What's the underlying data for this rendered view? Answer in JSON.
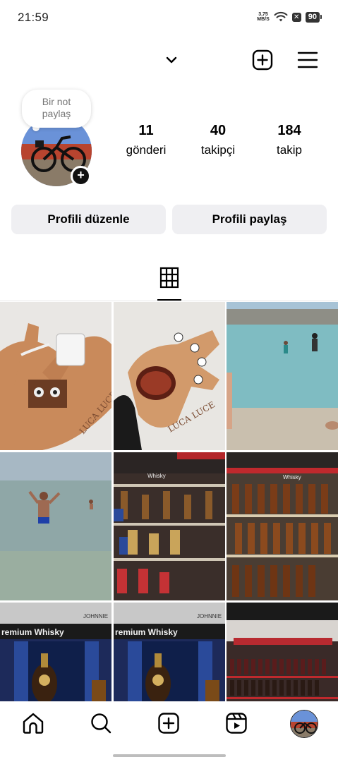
{
  "status_bar": {
    "time": "21:59",
    "net_speed_value": "3,75",
    "net_speed_unit": "MB/S",
    "sim_icon": "x-box-icon",
    "battery": "90"
  },
  "header": {
    "username_dropdown_icon": "chevron-down-icon",
    "new_post_icon": "plus-square-icon",
    "menu_icon": "hamburger-menu-icon"
  },
  "profile": {
    "note_bubble": "Bir not\npaylaş",
    "stats": [
      {
        "value": "11",
        "label": "gönderi"
      },
      {
        "value": "40",
        "label": "takipçi"
      },
      {
        "value": "184",
        "label": "takip"
      }
    ],
    "edit_button": "Profili düzenle",
    "share_button": "Profili paylaş"
  },
  "tabs": {
    "active": "grid-icon"
  },
  "grid": {
    "posts": [
      {
        "subject": "hand illusion with charger",
        "caption_overlay": "LUCA LUCE"
      },
      {
        "subject": "hand illusion with mouth",
        "caption_overlay": "LUCA LUCE"
      },
      {
        "subject": "beach with people in water"
      },
      {
        "subject": "man waving in sea"
      },
      {
        "subject": "whisky shelves in store"
      },
      {
        "subject": "whisky bottles on shelves"
      },
      {
        "subject": "premium whisky display",
        "caption_overlay": "remium Whisky"
      },
      {
        "subject": "premium whisky display",
        "caption_overlay": "remium Whisky"
      },
      {
        "subject": "wine store shelves"
      }
    ],
    "shelf_labels": [
      "Whisky",
      "Whisky",
      "JOHNNIE",
      "JOHNNIE"
    ]
  },
  "bottom_nav": {
    "items": [
      "home-icon",
      "search-icon",
      "create-icon",
      "reels-icon",
      "profile-avatar"
    ]
  },
  "colors": {
    "button_bg": "#efeff2",
    "text": "#000000",
    "muted": "#777777"
  }
}
